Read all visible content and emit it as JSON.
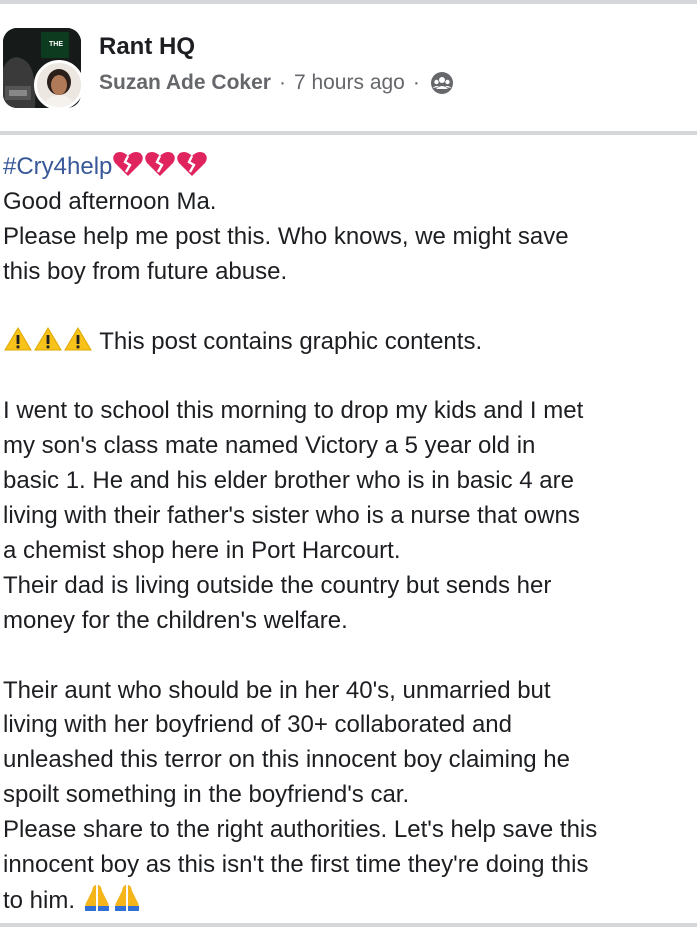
{
  "header": {
    "group_name": "Rant HQ",
    "author": "Suzan Ade Coker",
    "separator": "·",
    "time": "7 hours ago",
    "privacy_icon": "group-audience-icon"
  },
  "post": {
    "hashtag": "#Cry4help",
    "hashtag_emoji": "broken-heart-icon",
    "lines": [
      "Good afternoon Ma.",
      "Please help me post this. Who knows, we might save",
      "this boy from future abuse.",
      "",
      "This post contains graphic contents.",
      "",
      "I went to school this morning to drop my kids and I met",
      "my son's class mate named Victory a 5 year old in",
      "basic 1. He and his elder brother who is in basic 4 are",
      "living with their father's sister who is a nurse that owns",
      "a chemist shop here in Port Harcourt.",
      "Their dad is living outside the country but sends her",
      "money for the children's welfare.",
      "",
      "Their aunt who should be in her 40's, unmarried but",
      "living with her boyfriend of 30+ collaborated and",
      "unleashed this terror on this innocent boy claiming he",
      "spoilt something in the boyfriend's car.",
      "Please share to the right authorities. Let's help save this",
      "innocent boy as this isn't the first time they're doing this",
      "to him."
    ],
    "warning_emoji": "warning-icon",
    "closing_emoji": "folded-hands-icon"
  },
  "colors": {
    "hashtag": "#385898",
    "meta_text": "#65676b",
    "divider": "#d5d6d9",
    "heart": "#e0245e"
  }
}
